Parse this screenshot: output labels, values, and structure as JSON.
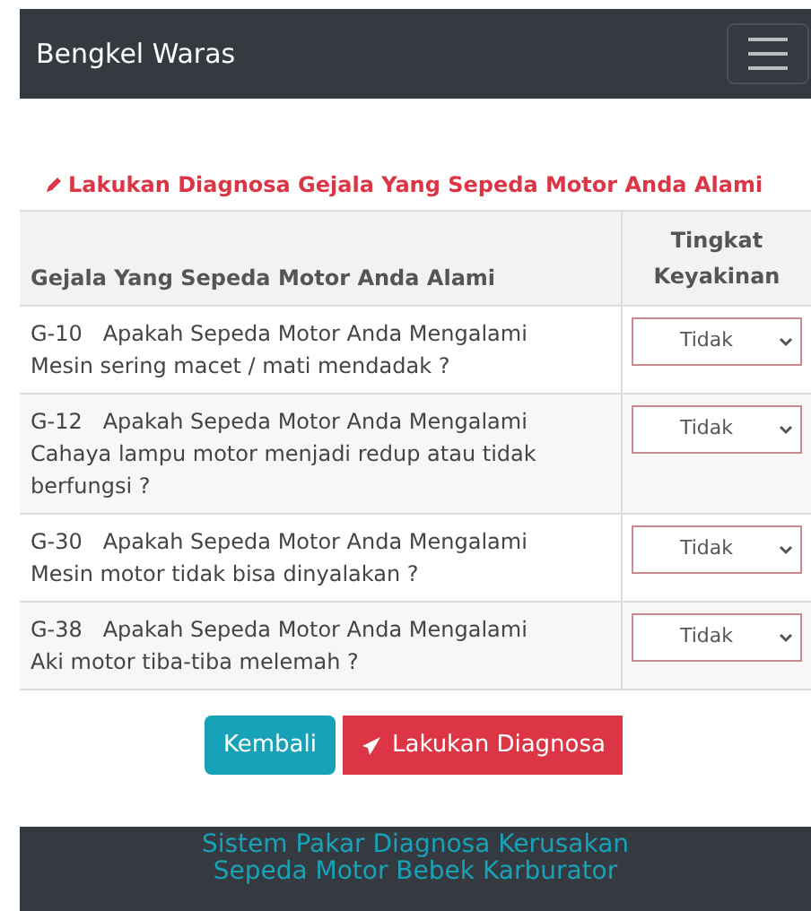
{
  "navbar": {
    "brand": "Bengkel Waras"
  },
  "heading": "Lakukan Diagnosa Gejala Yang Sepeda Motor Anda Alami",
  "table": {
    "columns": [
      "Gejala Yang Sepeda Motor Anda Alami",
      "Tingkat Keyakinan"
    ],
    "rows": [
      {
        "code": "G-10",
        "question": "Apakah Sepeda Motor Anda Mengalami",
        "symptom": "Mesin sering macet / mati mendadak ?",
        "answer": "Tidak"
      },
      {
        "code": "G-12",
        "question": "Apakah Sepeda Motor Anda Mengalami",
        "symptom": "Cahaya lampu motor menjadi redup atau tidak berfungsi ?",
        "answer": "Tidak"
      },
      {
        "code": "G-30",
        "question": "Apakah Sepeda Motor Anda Mengalami",
        "symptom": "Mesin motor tidak bisa dinyalakan ?",
        "answer": "Tidak"
      },
      {
        "code": "G-38",
        "question": "Apakah Sepeda Motor Anda Mengalami",
        "symptom": "Aki motor tiba-tiba melemah ?",
        "answer": "Tidak"
      }
    ]
  },
  "buttons": [
    {
      "label": "Kembali",
      "kind": "back"
    },
    {
      "label": "Lakukan Diagnosa",
      "kind": "submit"
    }
  ],
  "footer": [
    "Sistem Pakar Diagnosa Kerusakan",
    "Sepeda Motor Bebek Karburator"
  ]
}
